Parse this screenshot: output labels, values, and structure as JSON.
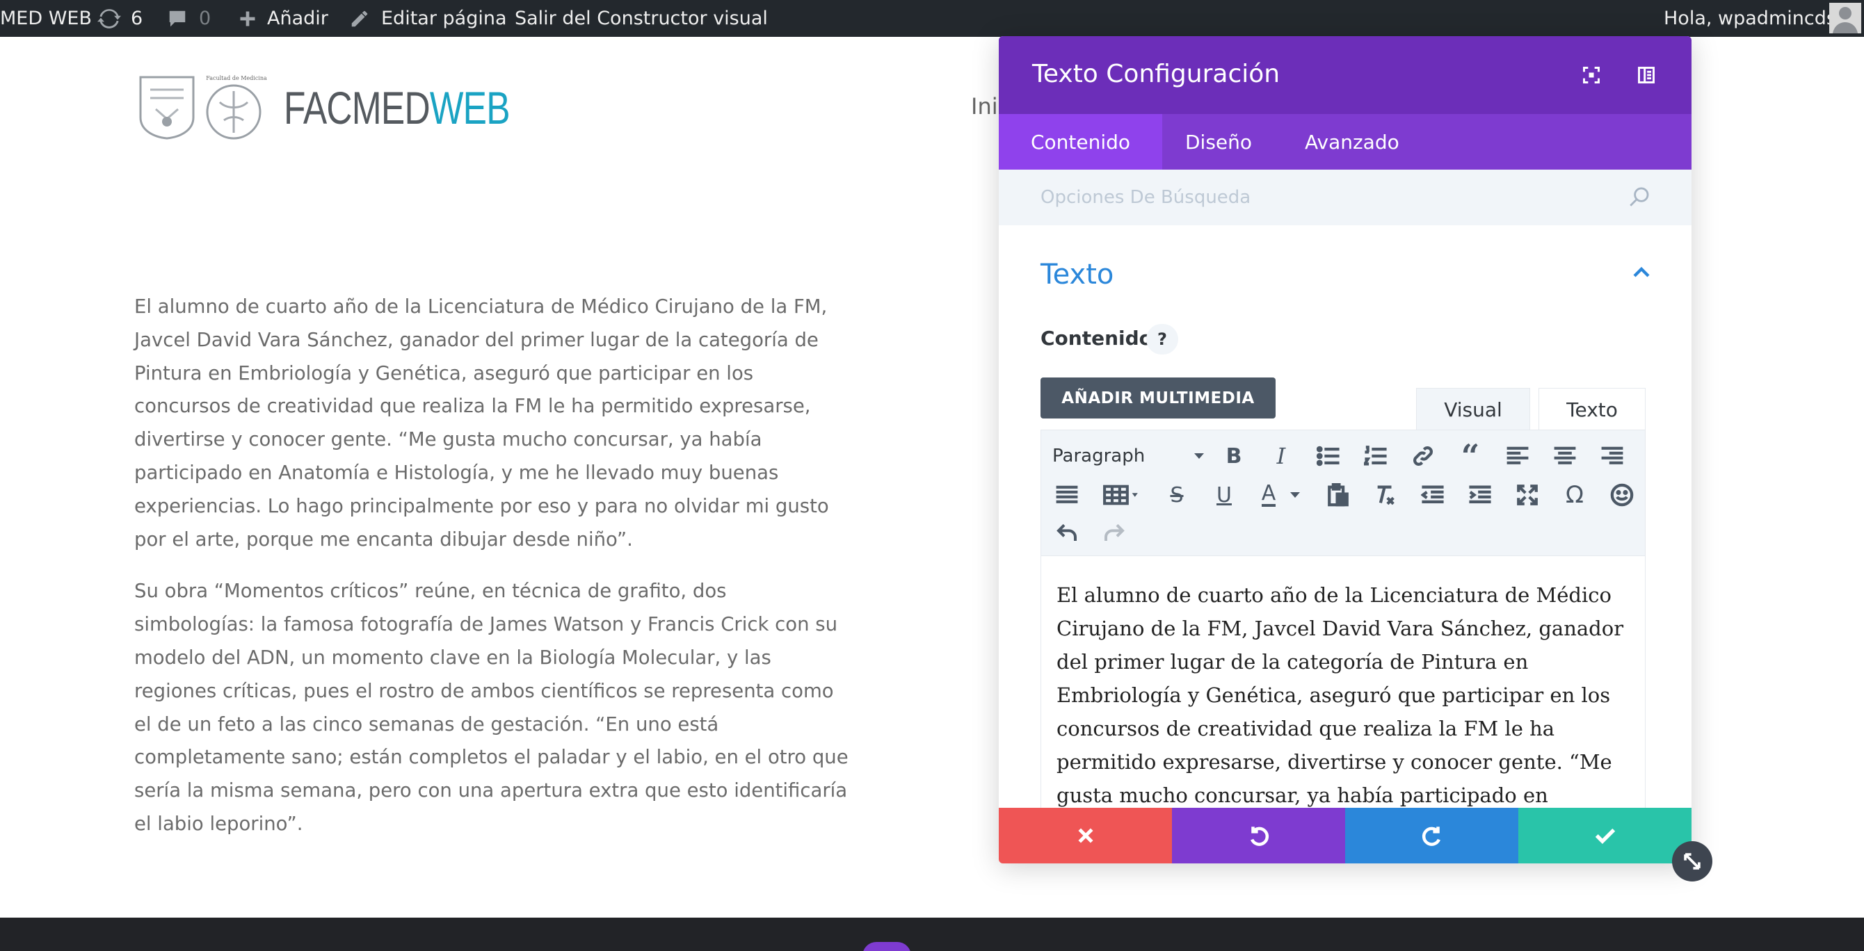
{
  "admin_bar": {
    "site_name": "MED WEB",
    "updates_count": "6",
    "comments_count": "0",
    "add_label": "Añadir",
    "edit_label": "Editar página",
    "exit_label": "Salir del Constructor visual",
    "greeting": "Hola, wpadmincds"
  },
  "site": {
    "logo_caption": "Facultad de Medicina",
    "name_part1": "FACMED",
    "name_part2": "WEB",
    "name_color": "#1aa3c3",
    "nav_fragment": "Ini"
  },
  "article": {
    "paragraphs": [
      "El alumno de cuarto año de la Licenciatura de Médico Cirujano de la FM, Javcel David Vara Sánchez, ganador del primer lugar de la categoría de Pintura en Embriología y Genética, aseguró que participar en los concursos de creatividad que realiza la FM le ha permitido expresarse, divertirse y conocer gente. “Me gusta mucho concursar, ya había participado en Anatomía e Histología, y me he llevado muy buenas experiencias. Lo hago principalmente por eso y para no olvidar mi gusto por el arte, porque me encanta dibujar desde niño”.",
      "Su obra “Momentos críticos” reúne, en técnica de grafito, dos simbologías: la famosa fotografía de James Watson y Francis Crick con su modelo del ADN, un momento clave en la Biología Molecular, y las regiones críticas, pues el rostro de ambos científicos se representa como el de un feto a las cinco semanas de gestación. “En uno está completamente sano; están completos el paladar y el labio, en el otro que sería la misma semana, pero con una apertura extra que esto identificaría el labio leporino”."
    ]
  },
  "modal": {
    "title": "Texto Configuración",
    "colors": {
      "header": "#6c2eb9",
      "tabs": "#7e3bd0",
      "active_tab": "#8f42ec"
    },
    "tabs": [
      {
        "label": "Contenido",
        "active": true
      },
      {
        "label": "Diseño",
        "active": false
      },
      {
        "label": "Avanzado",
        "active": false
      }
    ],
    "search_placeholder": "Opciones De Búsqueda",
    "section_title": "Texto",
    "field_label": "Contenido",
    "help_label": "?",
    "media_button": "AÑADIR MULTIMEDIA",
    "editor_tabs": {
      "visual": "Visual",
      "text": "Texto"
    },
    "format_select": "Paragraph",
    "toolbar_icons": [
      "bold-icon",
      "italic-icon",
      "bullet-list-icon",
      "numbered-list-icon",
      "link-icon",
      "blockquote-icon",
      "align-left-icon",
      "align-center-icon",
      "align-right-icon",
      "justify-icon",
      "table-icon",
      "strikethrough-icon",
      "underline-icon",
      "text-color-icon",
      "paste-icon",
      "clear-format-icon",
      "outdent-icon",
      "indent-icon",
      "fullscreen-icon",
      "omega-icon",
      "emoji-icon",
      "undo-icon",
      "redo-icon"
    ],
    "editor_content": "El alumno de cuarto año de la Licenciatura de Médico Cirujano de la FM, Javcel David Vara Sánchez, ganador del primer lugar de la categoría de Pintura en Embriología y Genética, aseguró que participar en los concursos de creatividad que realiza la FM le ha permitido expresarse, divertirse y conocer gente. “Me gusta mucho concursar, ya había participado en Anatomía e Histología, y me he",
    "footer_colors": {
      "cancel": "#ef5555",
      "undo": "#7e3bd0",
      "redo": "#2b87da",
      "save": "#29c4a9"
    }
  }
}
